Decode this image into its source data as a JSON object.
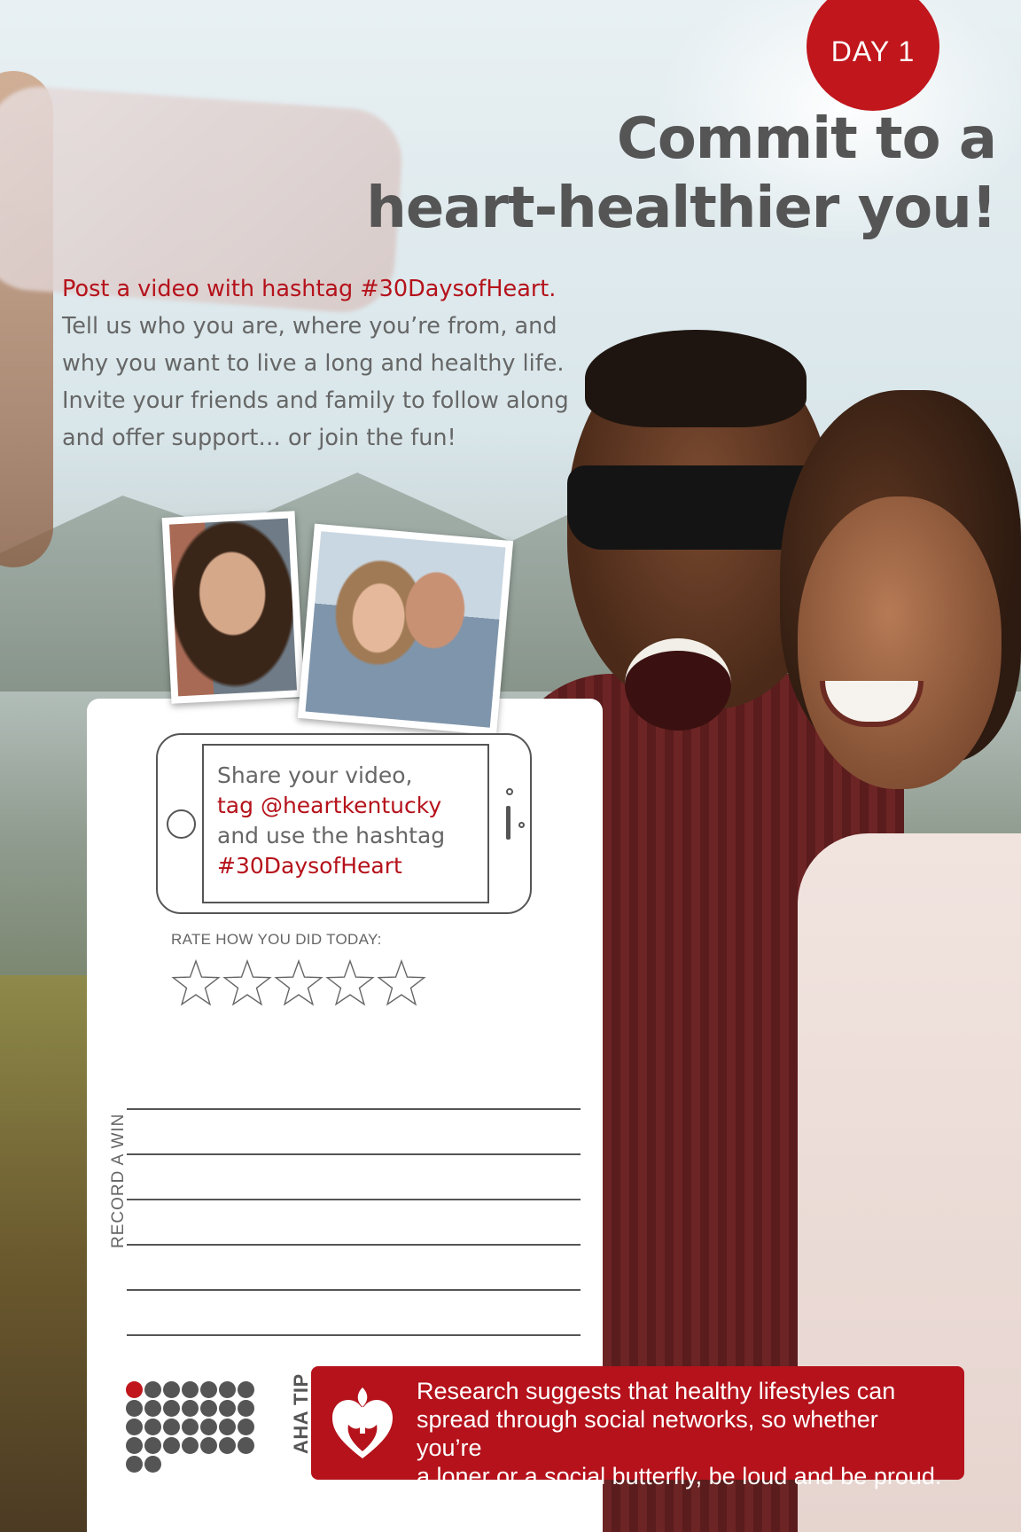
{
  "day_badge": "DAY 1",
  "headline": {
    "line1": "Commit to a",
    "line2": "heart-healthier you!"
  },
  "intro": {
    "highlight": "Post a video with hashtag #30DaysofHeart.",
    "line1": "Tell us who you are, where you’re from, and",
    "line2": "why you want to live a long and healthy life.",
    "line3": "Invite your friends and family to follow along",
    "line4": "and offer support… or join the fun!"
  },
  "share": {
    "line1": "Share your video,",
    "line2": "tag @heartkentucky",
    "line3": "and use the hashtag",
    "line4": "#30DaysofHeart"
  },
  "rating": {
    "label": "RATE HOW YOU DID TODAY:",
    "max_stars": 5,
    "value": 0
  },
  "record_win": {
    "label": "RECORD A WIN",
    "line_count": 6
  },
  "progress_dots": {
    "total": 30,
    "completed": 1
  },
  "tip": {
    "label": "AHA TIP",
    "line1": "Research suggests that healthy lifestyles can",
    "line2": "spread through social networks, so whether you’re",
    "line3": "a loner or a social butterfly, be loud and be proud.",
    "logo_icon": "heart-torch-logo-icon"
  },
  "colors": {
    "brand_red": "#c0161c",
    "text_gray": "#666666"
  }
}
